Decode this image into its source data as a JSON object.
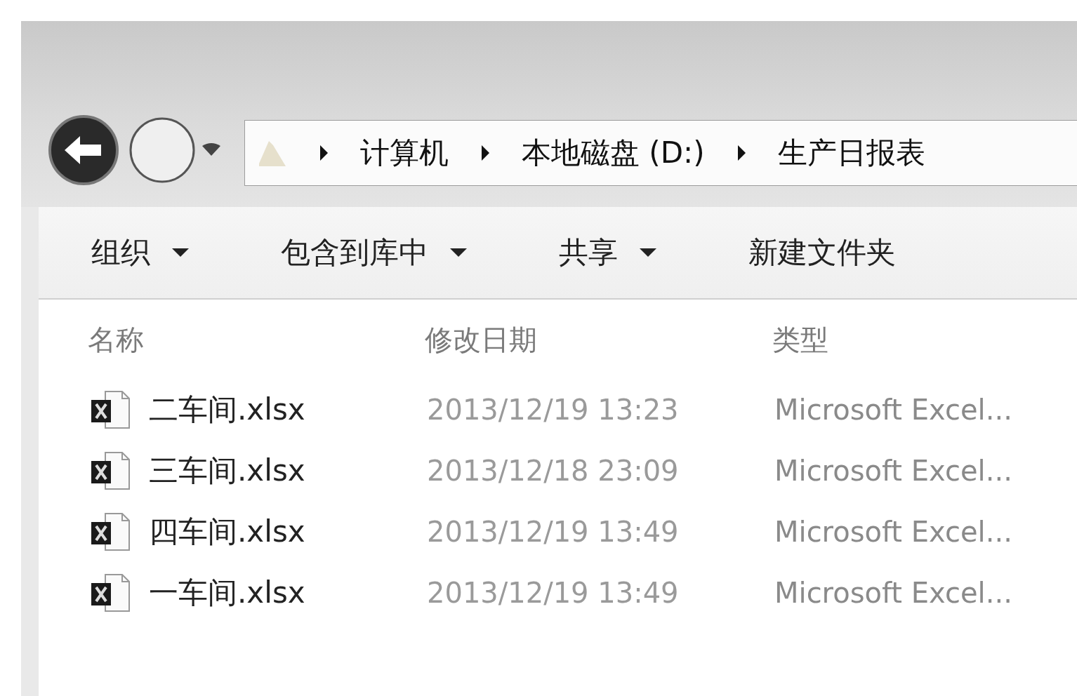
{
  "navigation": {
    "breadcrumb": [
      {
        "label": "计算机"
      },
      {
        "label": "本地磁盘 (D:)"
      },
      {
        "label": "生产日报表"
      }
    ]
  },
  "toolbar": {
    "items": [
      {
        "label": "组织",
        "dropdown": true
      },
      {
        "label": "包含到库中",
        "dropdown": true
      },
      {
        "label": "共享",
        "dropdown": true
      },
      {
        "label": "新建文件夹",
        "dropdown": false
      }
    ]
  },
  "file_list": {
    "columns": [
      "名称",
      "修改日期",
      "类型"
    ],
    "rows": [
      {
        "name": "二车间.xlsx",
        "modified": "2013/12/19 13:23",
        "type": "Microsoft Excel..."
      },
      {
        "name": "三车间.xlsx",
        "modified": "2013/12/18 23:09",
        "type": "Microsoft Excel..."
      },
      {
        "name": "四车间.xlsx",
        "modified": "2013/12/19 13:49",
        "type": "Microsoft Excel..."
      },
      {
        "name": "一车间.xlsx",
        "modified": "2013/12/19 13:49",
        "type": "Microsoft Excel..."
      }
    ]
  }
}
